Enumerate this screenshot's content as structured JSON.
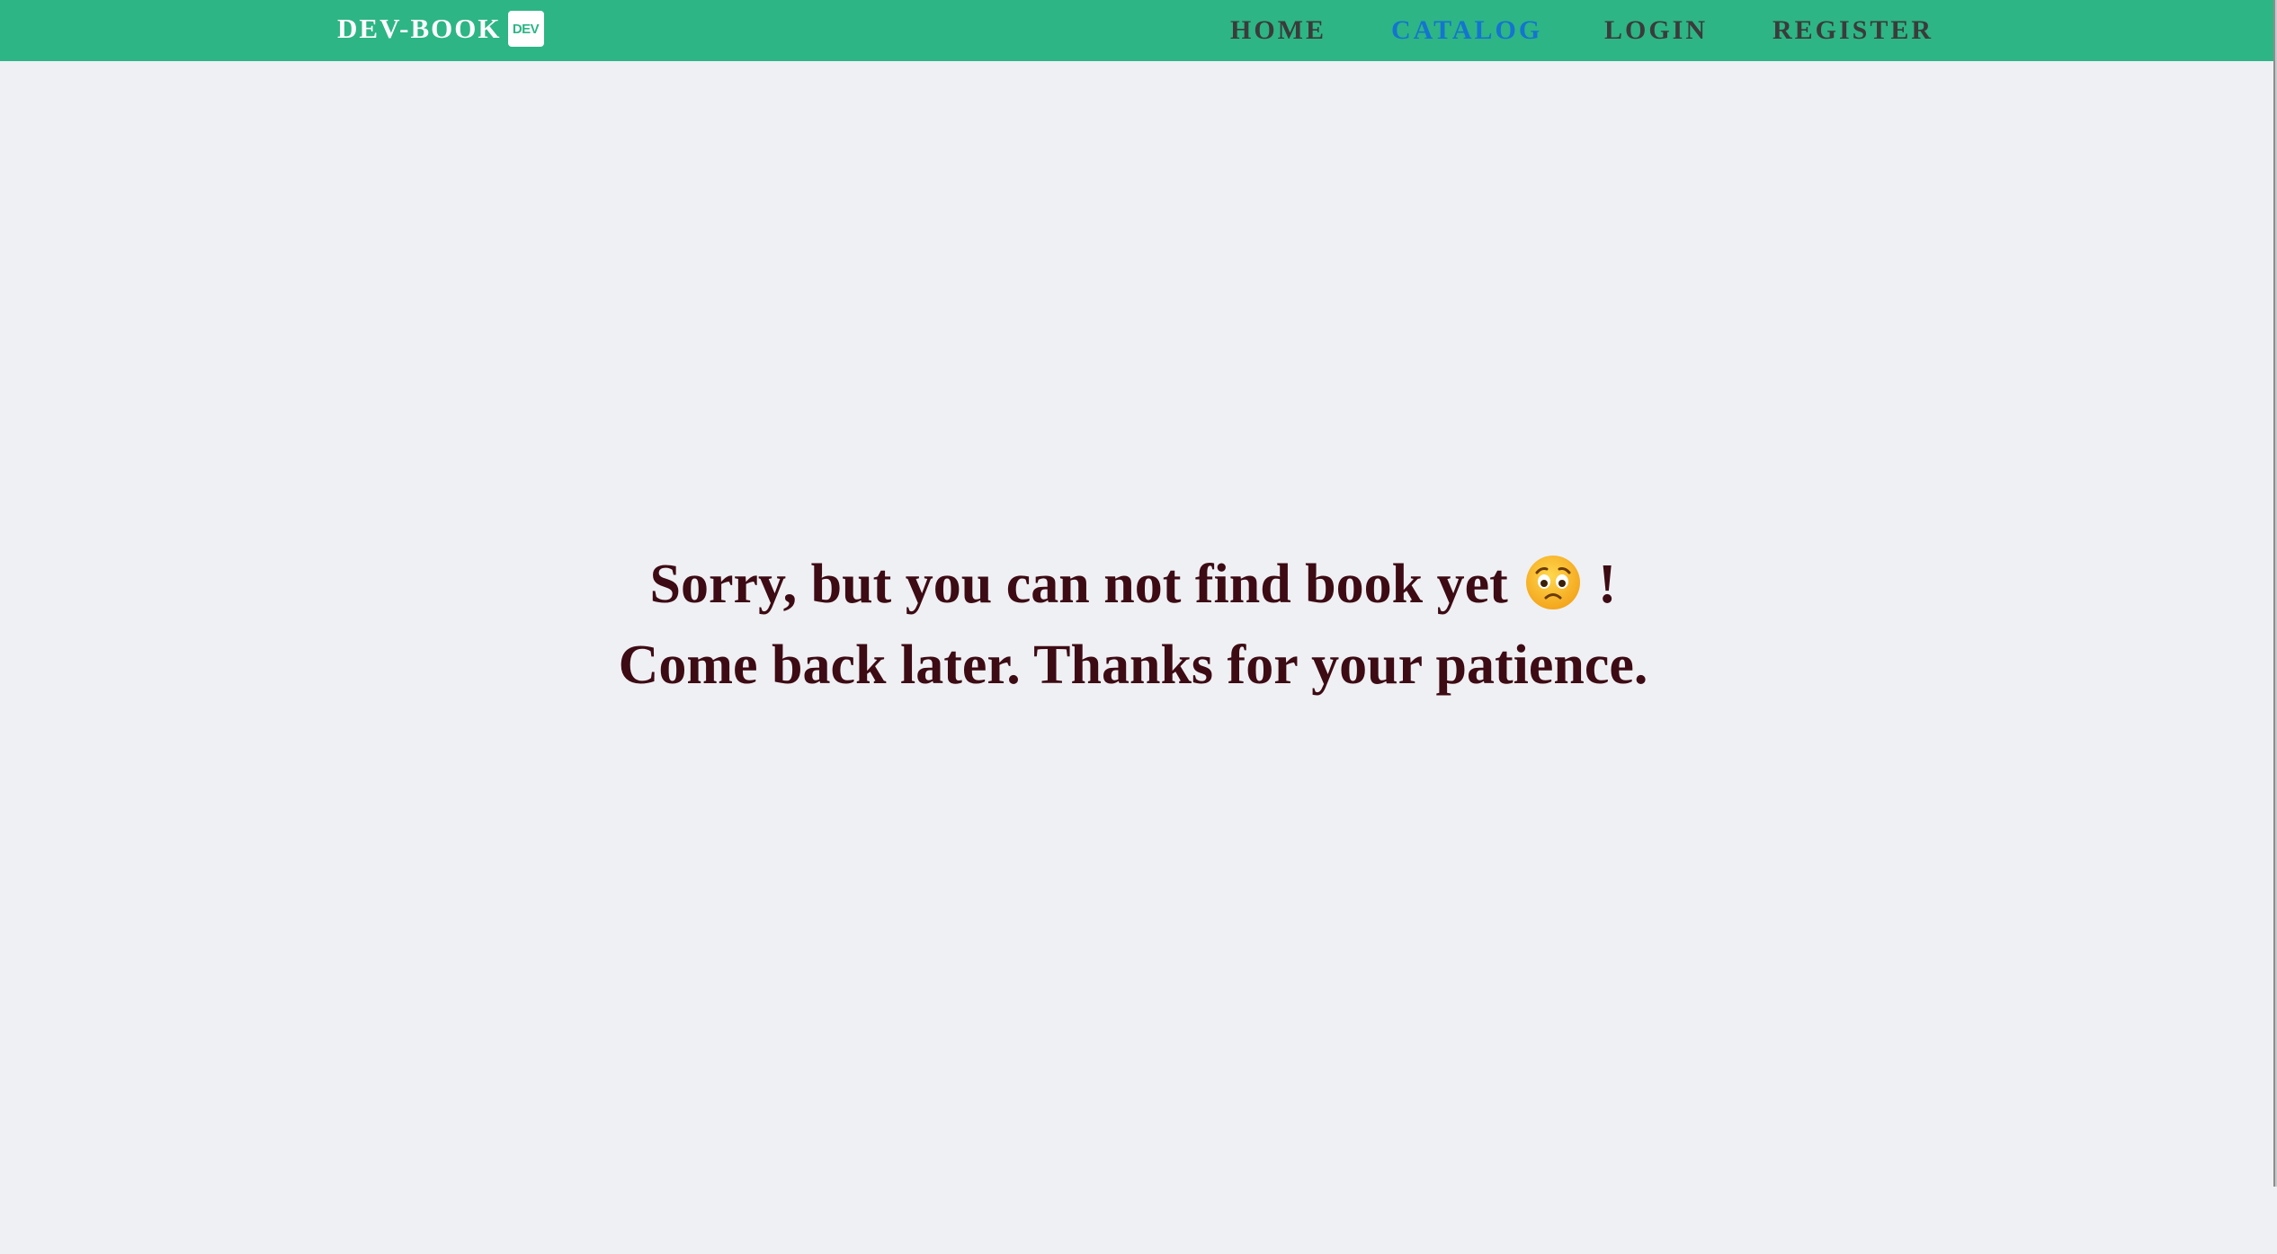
{
  "brand": {
    "name": "DEV-BOOK",
    "badge": "DEV"
  },
  "nav": {
    "items": [
      {
        "label": "HOME",
        "active": false
      },
      {
        "label": "CATALOG",
        "active": true
      },
      {
        "label": "LOGIN",
        "active": false
      },
      {
        "label": "REGISTER",
        "active": false
      }
    ]
  },
  "colors": {
    "navbar": "#2db585",
    "page_background": "#eff0f3",
    "nav_text": "#3b3b3b",
    "nav_active": "#1474d0",
    "message_text": "#3d0b14"
  },
  "message": {
    "line1_before_emoji": "Sorry, but you can not find book yet",
    "emoji_icon": "worried-face-icon",
    "line1_after_emoji": "!",
    "line2": "Come back later. Thanks for your patience."
  }
}
